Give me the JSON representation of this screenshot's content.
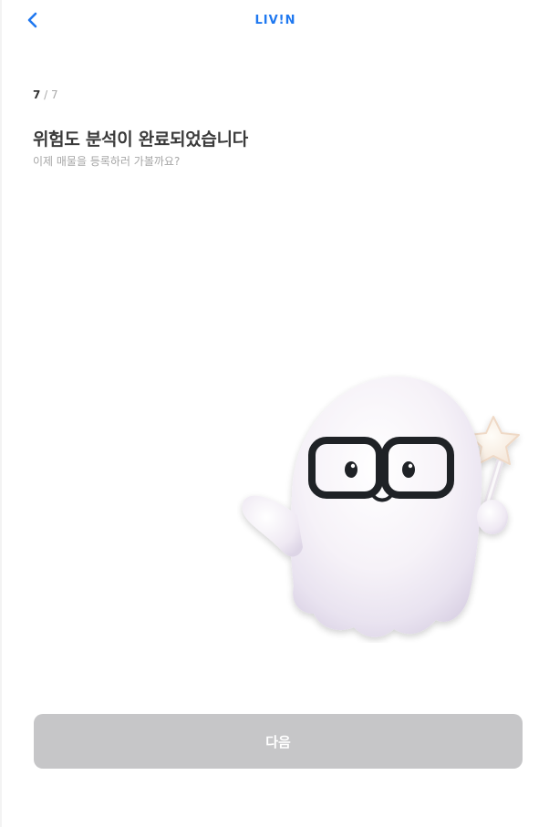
{
  "header": {
    "back_icon": "chevron-left-icon",
    "logo_text": "LIV!N",
    "accent_color": "#1f78f0"
  },
  "progress": {
    "current": "7",
    "separator": " / ",
    "total": "7"
  },
  "content": {
    "title": "위험도 분석이 완료되었습니다",
    "subtitle": "이제 매물을 등록하러 가볼까요?"
  },
  "illustration": {
    "name": "ghost-with-glasses-and-star-wand"
  },
  "footer": {
    "next_label": "다음",
    "button_color": "#c6c6c8",
    "disabled": true
  }
}
